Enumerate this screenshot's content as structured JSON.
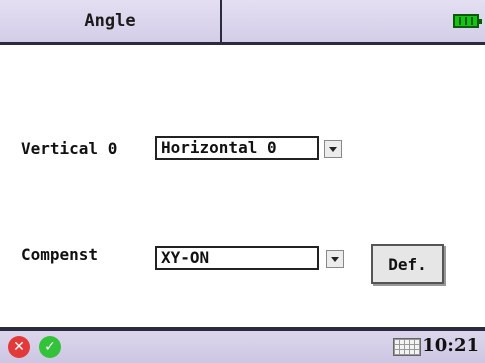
{
  "header": {
    "tab_title": "Angle",
    "battery_icon": "battery-full-icon"
  },
  "form": {
    "vertical_label": "Vertical 0",
    "vertical_value": "Horizontal 0",
    "compensate_label": "Compenst",
    "compensate_value": "XY-ON",
    "default_button": "Def."
  },
  "footer": {
    "cancel_icon": "cancel-icon",
    "ok_icon": "ok-icon",
    "keyboard_icon": "keyboard-icon",
    "time": "10:21"
  },
  "colors": {
    "bar_background": "#d3cde8",
    "border_dark": "#2c2a3e",
    "battery_green": "#13c413",
    "cancel_red": "#e23a3a",
    "ok_green": "#33c23a"
  }
}
